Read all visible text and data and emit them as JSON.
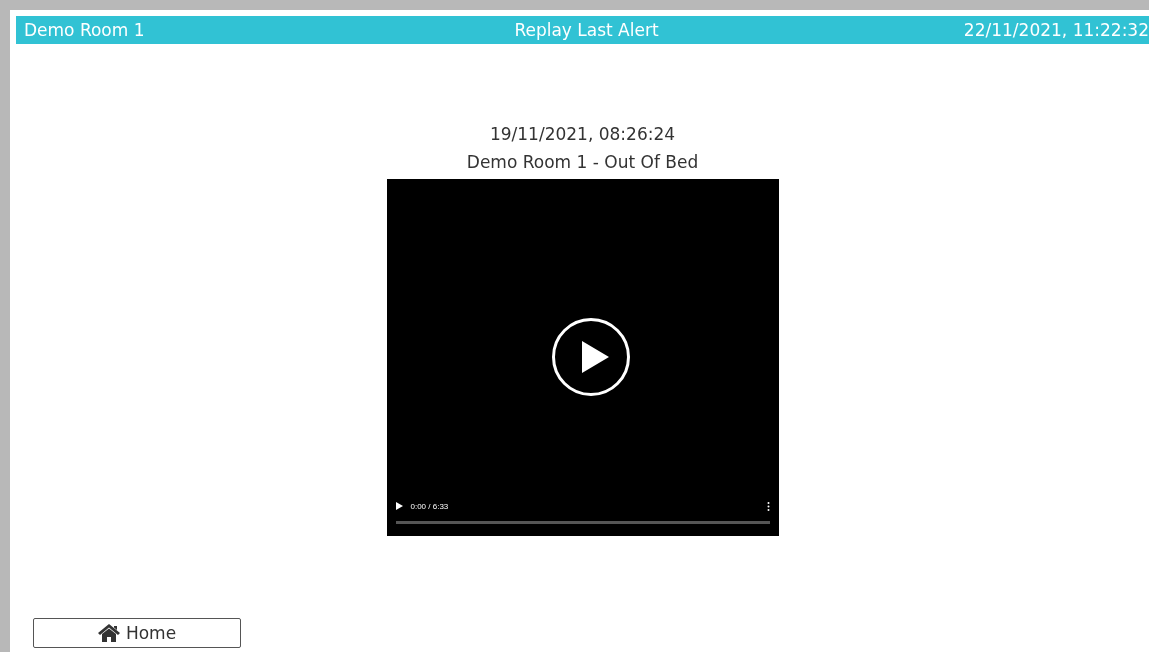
{
  "header": {
    "room": "Demo Room 1",
    "title": "Replay Last Alert",
    "datetime": "22/11/2021, 11:22:32"
  },
  "alert": {
    "timestamp": "19/11/2021, 08:26:24",
    "description": "Demo Room 1 - Out Of Bed"
  },
  "video": {
    "time": "0:00 / 6:33",
    "progress": {
      "level": 0
    }
  },
  "home_button": {
    "label": "Home"
  }
}
